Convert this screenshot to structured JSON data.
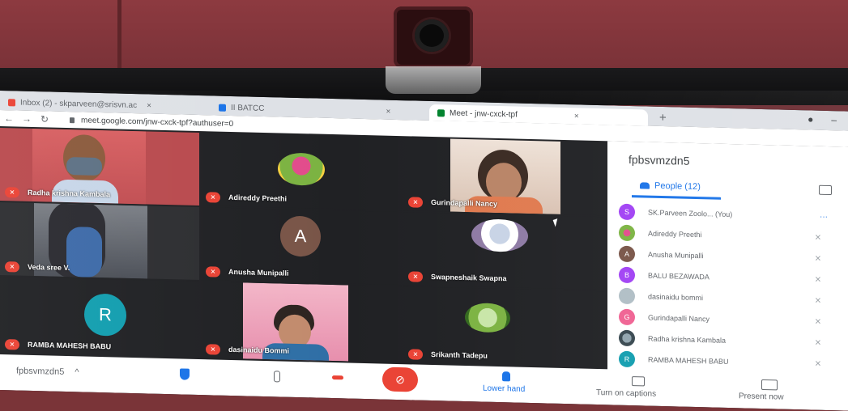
{
  "browser": {
    "tabs": [
      {
        "label": "Inbox (2) - skparveen@srisvn.ac",
        "favicon_color": "#ea4335",
        "close": "×"
      },
      {
        "label": "II BATCC",
        "favicon_color": "#1a73e8",
        "close": "×"
      },
      {
        "label": "Meet - jnw-cxck-tpf",
        "favicon_color": "#00832d",
        "close": "×",
        "active": true
      }
    ],
    "new_tab": "+",
    "nav": {
      "back": "←",
      "forward": "→",
      "reload": "↻"
    },
    "url": "meet.google.com/jnw-cxck-tpf?authuser=0",
    "window_controls": {
      "menu": "●",
      "minimize": "–"
    }
  },
  "meeting": {
    "code": "fpbsvmzdn5",
    "tiles": [
      {
        "name": "Radha krishna Kambala",
        "kind": "video",
        "muted": true
      },
      {
        "name": "Adireddy Preethi",
        "kind": "photo-avatar",
        "muted": true
      },
      {
        "name": "Gurindapalli Nancy",
        "kind": "video",
        "muted": true
      },
      {
        "name": "Veda sree V.",
        "kind": "video",
        "muted": true
      },
      {
        "name": "Anusha Munipalli",
        "kind": "letter-avatar",
        "letter": "A",
        "color": "#795548",
        "muted": true
      },
      {
        "name": "Swapneshaik Swapna",
        "kind": "photo-avatar",
        "muted": true
      },
      {
        "name": "RAMBA MAHESH BABU",
        "kind": "letter-avatar",
        "letter": "R",
        "color": "#129eaf",
        "muted": true
      },
      {
        "name": "dasinaidu Bommi",
        "kind": "video",
        "muted": true
      },
      {
        "name": "Srikanth Tadepu",
        "kind": "photo-avatar",
        "muted": true
      }
    ]
  },
  "people_panel": {
    "title": "fpbsvmzdn5",
    "tab_label": "People (12)",
    "people": [
      {
        "name": "SK.Parveen Zoolo...  (You)",
        "initial": "S",
        "color": "#a142f4",
        "you": true
      },
      {
        "name": "Adireddy Preethi",
        "initial": "",
        "color": "#7cb342"
      },
      {
        "name": "Anusha Munipalli",
        "initial": "A",
        "color": "#795548"
      },
      {
        "name": "BALU BEZAWADA",
        "initial": "B",
        "color": "#a142f4"
      },
      {
        "name": "dasinaidu bommi",
        "initial": "",
        "color": "#9e9e9e"
      },
      {
        "name": "Gurindapalli Nancy",
        "initial": "G",
        "color": "#f06292"
      },
      {
        "name": "Radha krishna Kambala",
        "initial": "",
        "color": "#546e7a"
      },
      {
        "name": "RAMBA MAHESH BABU",
        "initial": "R",
        "color": "#129eaf"
      }
    ],
    "muted_icon": "mic-off-icon",
    "more_icon": "···"
  },
  "bottom_bar": {
    "meeting_code": "fpbsvmzdn5",
    "chevron": "^",
    "raise_hand_label": "Lower hand",
    "captions_label": "Turn on captions",
    "present_label": "Present now",
    "camera_off_glyph": "⊘"
  }
}
